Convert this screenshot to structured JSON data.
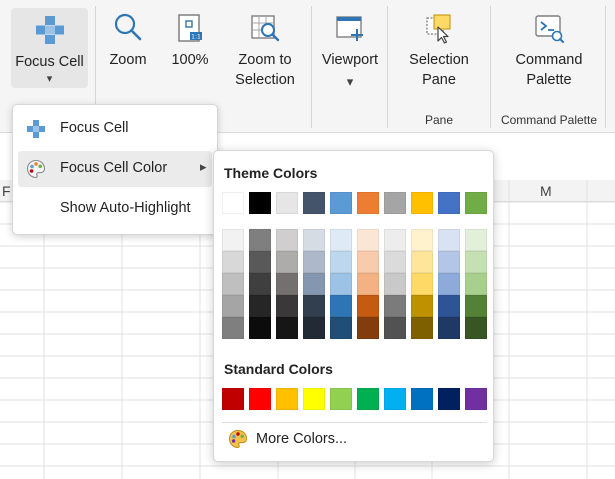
{
  "ribbon": {
    "focus_cell": {
      "label": "Focus Cell",
      "icon": "focus-cell-icon",
      "arrow": "▾"
    },
    "zoom": {
      "label": "Zoom",
      "icon": "magnifier-icon"
    },
    "zoom100": {
      "label": "100%",
      "icon": "zoom-100-icon"
    },
    "zoom_to_selection": {
      "line1": "Zoom to",
      "line2": "Selection",
      "icon": "zoom-selection-icon"
    },
    "viewport": {
      "label": "Viewport",
      "icon": "viewport-icon",
      "arrow": "▾"
    },
    "selection_pane": {
      "line1": "Selection",
      "line2": "Pane",
      "icon": "selection-pane-icon"
    },
    "command_palette": {
      "line1": "Command",
      "line2": "Palette",
      "icon": "command-palette-icon"
    },
    "groups": {
      "pane": "Pane",
      "command_palette": "Command Palette"
    }
  },
  "sheet": {
    "col_left": "F",
    "col_right": "M"
  },
  "menu": {
    "items": [
      {
        "label": "Focus Cell",
        "icon": "focus-cell-icon"
      },
      {
        "label": "Focus Cell Color",
        "icon": "palette-icon",
        "arrow": "▸"
      },
      {
        "label": "Show Auto-Highlight"
      }
    ]
  },
  "colors": {
    "theme_title": "Theme Colors",
    "standard_title": "Standard Colors",
    "more_label": "More Colors...",
    "theme_top": [
      "#ffffff",
      "#000000",
      "#e7e6e6",
      "#44546a",
      "#5b9bd5",
      "#ed7d31",
      "#a5a5a5",
      "#ffc000",
      "#4472c4",
      "#70ad47"
    ],
    "theme_shades": [
      [
        "#f2f2f2",
        "#7f7f7f",
        "#d0cece",
        "#d6dce4",
        "#deebf6",
        "#fbe5d5",
        "#ededed",
        "#fff2cc",
        "#d9e2f3",
        "#e2efd9"
      ],
      [
        "#d8d8d8",
        "#595959",
        "#aeabab",
        "#adb9ca",
        "#bdd7ee",
        "#f7cbac",
        "#dbdbdb",
        "#fee599",
        "#b4c6e7",
        "#c5e0b3"
      ],
      [
        "#bfbfbf",
        "#3f3f3f",
        "#757070",
        "#8496b0",
        "#9cc3e5",
        "#f4b183",
        "#c9c9c9",
        "#ffd965",
        "#8eaadb",
        "#a8d08d"
      ],
      [
        "#a5a5a5",
        "#262626",
        "#3a3838",
        "#323f4f",
        "#2e75b5",
        "#c55a11",
        "#7b7b7b",
        "#bf9000",
        "#2f5496",
        "#538135"
      ],
      [
        "#7f7f7f",
        "#0c0c0c",
        "#171616",
        "#222a35",
        "#1f4e79",
        "#833c0b",
        "#525252",
        "#7f6000",
        "#1f3864",
        "#375623"
      ]
    ],
    "standard": [
      "#c00000",
      "#ff0000",
      "#ffc000",
      "#ffff00",
      "#92d050",
      "#00b050",
      "#00b0f0",
      "#0070c0",
      "#002060",
      "#7030a0"
    ]
  }
}
